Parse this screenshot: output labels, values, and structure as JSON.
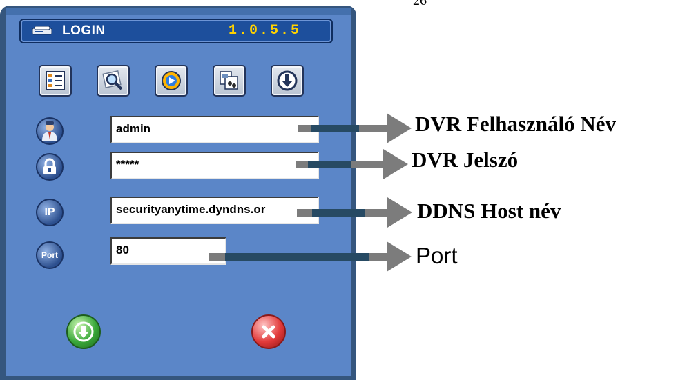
{
  "page_number": "26",
  "window": {
    "title": "LOGIN",
    "version": "1.0.5.5"
  },
  "toolbar": {
    "buttons": [
      {
        "icon": "list-icon"
      },
      {
        "icon": "search-icon"
      },
      {
        "icon": "playback-icon"
      },
      {
        "icon": "images-icon"
      },
      {
        "icon": "download-icon"
      }
    ]
  },
  "fields": {
    "username": {
      "icon": "user-icon",
      "value": "admin"
    },
    "password": {
      "icon": "lock-icon",
      "value": "*****"
    },
    "host": {
      "icon": "ip-icon",
      "icon_text": "IP",
      "value": "securityanytime.dyndns.or"
    },
    "port": {
      "icon": "port-icon",
      "icon_text": "Port",
      "value": "80"
    }
  },
  "actions": {
    "ok": {
      "icon": "login-icon"
    },
    "cancel": {
      "icon": "close-icon"
    }
  },
  "annotations": {
    "username": "DVR Felhasználó Név",
    "password": "DVR Jelszó",
    "host": "DDNS Host név",
    "port": "Port"
  },
  "colors": {
    "panel": "#5b86c8",
    "title_bar": "#1d4f9c",
    "version_text": "#ffd200",
    "arrow": "#7c7c7c"
  }
}
